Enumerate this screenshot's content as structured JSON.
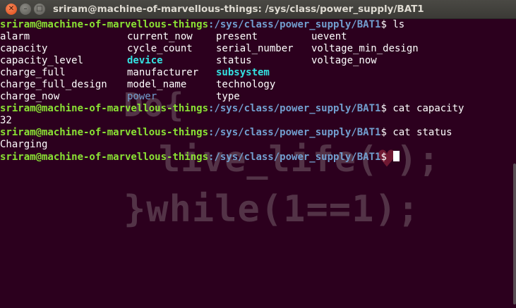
{
  "window": {
    "title": "sriram@machine-of-marvellous-things: /sys/class/power_supply/BAT1",
    "close_glyph": "✕",
    "min_glyph": "–",
    "max_glyph": "□"
  },
  "prompt": {
    "user_host": "sriram@machine-of-marvellous-things",
    "cwd": ":/sys/class/power_supply/BAT1",
    "symbol": "$ "
  },
  "commands": [
    {
      "cmd": "ls"
    },
    {
      "cmd": "cat capacity",
      "output": "32"
    },
    {
      "cmd": "cat status",
      "output": "Charging"
    }
  ],
  "ls_output": {
    "col1": [
      "alarm",
      "capacity",
      "capacity_level",
      "charge_full",
      "charge_full_design",
      "charge_now"
    ],
    "col2": [
      "current_now",
      "cycle_count",
      "device",
      "manufacturer",
      "model_name",
      "power"
    ],
    "col3": [
      "present",
      "serial_number",
      "status",
      "subsystem",
      "technology",
      "type"
    ],
    "col4": [
      "uevent",
      "voltage_min_design",
      "voltage_now"
    ]
  },
  "wallpaper": {
    "line1": "Do{",
    "line2_pre": "live_life(",
    "heart": "♥",
    "line2_post": ");",
    "line3": "}while(1==1);"
  },
  "colors": {
    "background": "#2c001e",
    "prompt_user": "#8ae234",
    "prompt_path": "#729fcf",
    "directory": "#34e2e2",
    "symlink": "#729fcf",
    "close_button": "#df4a16"
  }
}
